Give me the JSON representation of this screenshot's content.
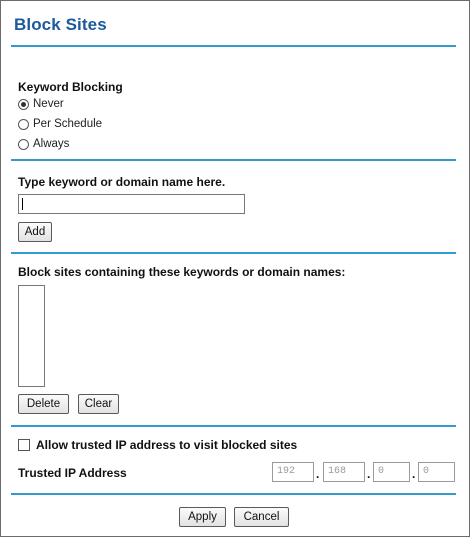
{
  "page": {
    "title": "Block Sites"
  },
  "keyword_blocking": {
    "heading": "Keyword Blocking",
    "options": [
      {
        "label": "Never",
        "selected": true
      },
      {
        "label": "Per Schedule",
        "selected": false
      },
      {
        "label": "Always",
        "selected": false
      }
    ]
  },
  "keyword_entry": {
    "label": "Type keyword or domain name here.",
    "value": "",
    "add_label": "Add"
  },
  "blocklist": {
    "heading": "Block sites containing these keywords or domain names:",
    "items": [],
    "delete_label": "Delete",
    "clear_label": "Clear"
  },
  "trusted": {
    "checkbox_label": "Allow trusted IP address to visit blocked sites",
    "checked": false,
    "ip_label": "Trusted IP Address",
    "ip_octets": [
      "192",
      "168",
      "0",
      "0"
    ]
  },
  "footer": {
    "apply_label": "Apply",
    "cancel_label": "Cancel"
  },
  "colors": {
    "accent_rule": "#2f9bd0",
    "title": "#1c5a9c"
  }
}
